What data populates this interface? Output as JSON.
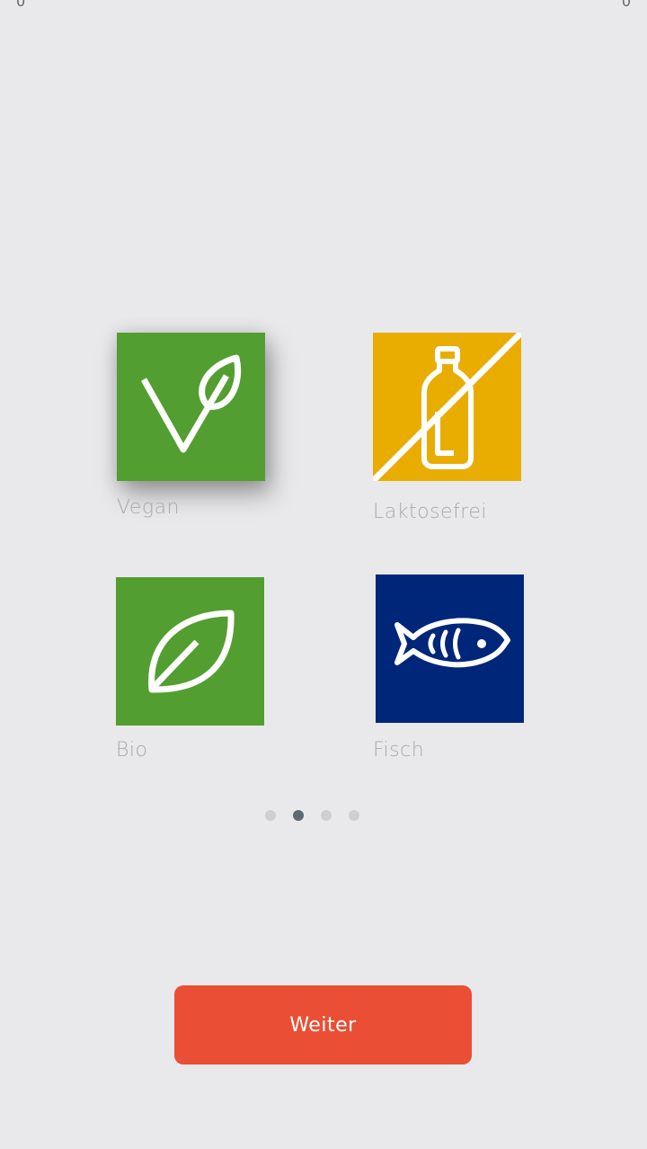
{
  "status": {
    "left": "0",
    "right": "0"
  },
  "options": [
    {
      "label": "Vegan",
      "icon": "vegan-leaf-v-icon",
      "color": "#529e30",
      "selected": true
    },
    {
      "label": "Laktosefrei",
      "icon": "crossed-milk-bottle-icon",
      "color": "#e9ac00",
      "selected": false
    },
    {
      "label": "Bio",
      "icon": "organic-leaf-icon",
      "color": "#529e30",
      "selected": false
    },
    {
      "label": "Fisch",
      "icon": "fish-icon",
      "color": "#00267a",
      "selected": false
    }
  ],
  "pager": {
    "page_count": 4,
    "active_index": 1
  },
  "buttons": {
    "next_label": "Weiter",
    "next_color": "#ea4e35"
  }
}
